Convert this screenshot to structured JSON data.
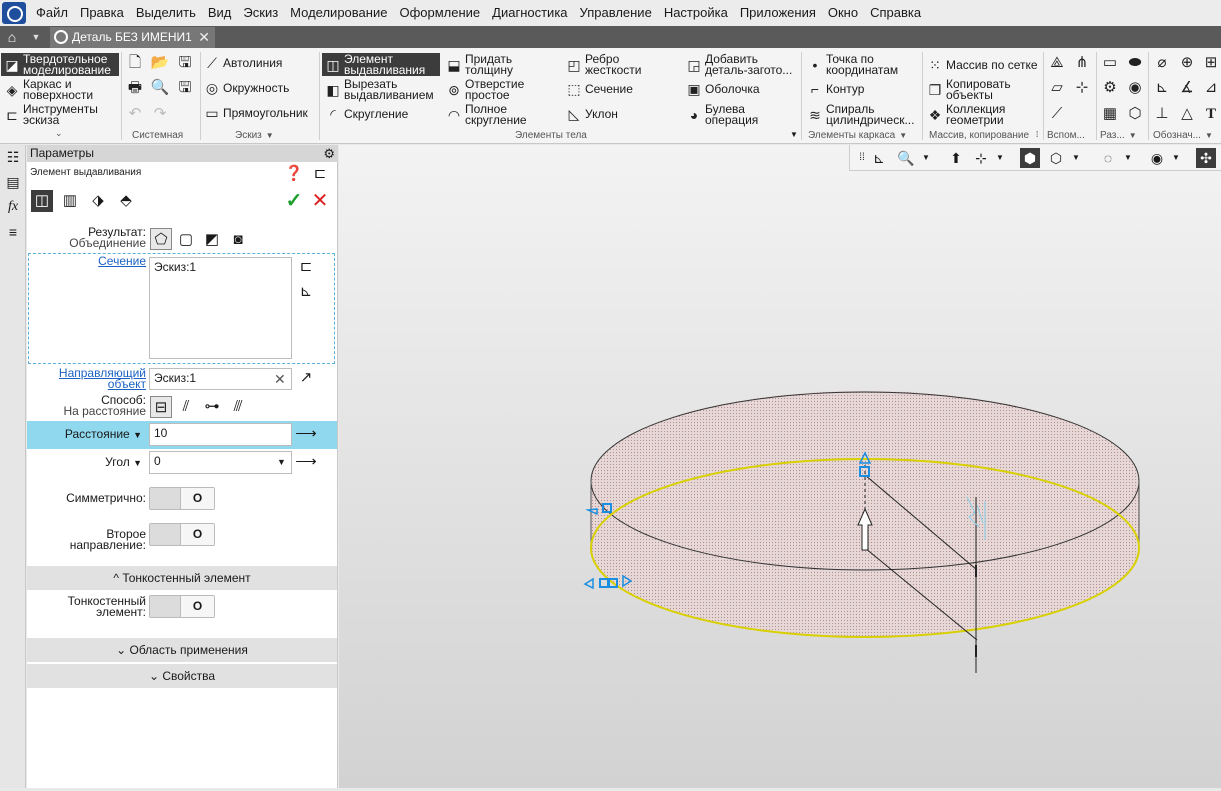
{
  "menu": [
    "Файл",
    "Правка",
    "Выделить",
    "Вид",
    "Эскиз",
    "Моделирование",
    "Оформление",
    "Диагностика",
    "Управление",
    "Настройка",
    "Приложения",
    "Окно",
    "Справка"
  ],
  "tab": {
    "title": "Деталь БЕЗ ИМЕНИ1"
  },
  "ribbon": {
    "modes": [
      {
        "l1": "Твердотельное",
        "l2": "моделирование"
      },
      {
        "l1": "Каркас и",
        "l2": "поверхности"
      },
      {
        "l1": "Инструменты",
        "l2": "эскиза"
      }
    ],
    "sketch": {
      "autoline": "Автолиния",
      "circle": "Окружность",
      "rect": "Прямоугольник"
    },
    "body": [
      {
        "l1": "Элемент",
        "l2": "выдавливания"
      },
      {
        "l1": "Вырезать",
        "l2": "выдавливанием"
      },
      {
        "l1": "Скругление",
        "l2": ""
      },
      {
        "l1": "Придать",
        "l2": "толщину"
      },
      {
        "l1": "Отверстие",
        "l2": "простое"
      },
      {
        "l1": "Полное",
        "l2": "скругление"
      },
      {
        "l1": "Ребро",
        "l2": "жесткости"
      },
      {
        "l1": "Сечение",
        "l2": ""
      },
      {
        "l1": "Уклон",
        "l2": ""
      },
      {
        "l1": "Добавить",
        "l2": "деталь-загото..."
      },
      {
        "l1": "Оболочка",
        "l2": ""
      },
      {
        "l1": "Булева",
        "l2": "операция"
      }
    ],
    "frame": [
      {
        "l1": "Точка по",
        "l2": "координатам"
      },
      {
        "l1": "Контур",
        "l2": ""
      },
      {
        "l1": "Спираль",
        "l2": "цилиндрическ..."
      }
    ],
    "massiv": [
      {
        "l1": "Массив по сетке",
        "l2": ""
      },
      {
        "l1": "Копировать",
        "l2": "объекты"
      },
      {
        "l1": "Коллекция",
        "l2": "геометрии"
      }
    ],
    "groups": {
      "system": "Системная",
      "sketch": "Эскиз",
      "body": "Элементы тела",
      "frame": "Элементы каркаса",
      "massiv": "Массив, копирование",
      "aux": "Вспом...",
      "raz": "Раз...",
      "oboz": "Обознач..."
    }
  },
  "panel": {
    "header": "Параметры",
    "subtitle": "Элемент выдавливания",
    "result_label1": "Результат:",
    "result_label2": "Объединение",
    "section_link": "Сечение",
    "section_value": "Эскиз:1",
    "guide_l1": "Направляющий",
    "guide_l2": "объект",
    "guide_value": "Эскиз:1",
    "method_l1": "Способ:",
    "method_l2": "На расстояние",
    "distance_label": "Расстояние",
    "distance_value": "10",
    "angle_label": "Угол",
    "angle_value": "0",
    "symmetric_label": "Симметрично:",
    "second_dir_label": "Второе направление:",
    "toggle_off": "O",
    "thin_section": "Тонкостенный элемент",
    "thin_l1": "Тонкостенный",
    "thin_l2": "элемент:",
    "apply_section": "Область применения",
    "props_section": "Свойства"
  }
}
